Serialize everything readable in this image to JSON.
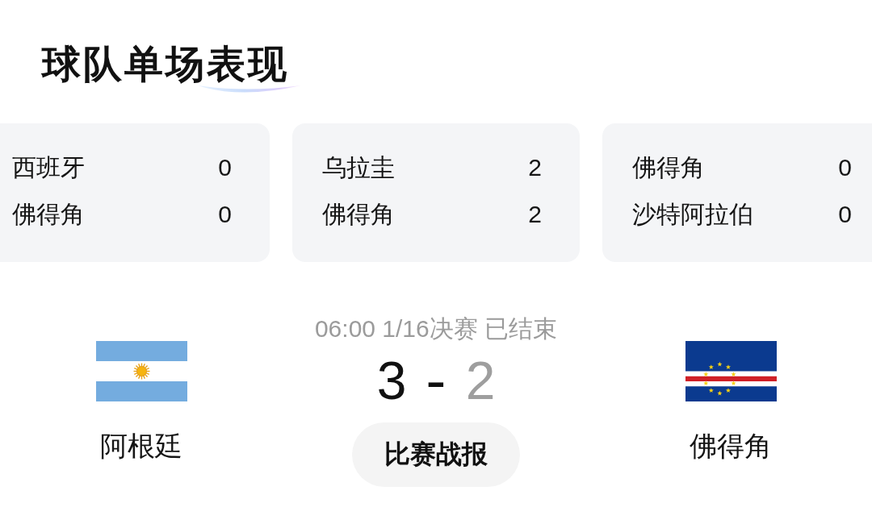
{
  "title": "球队单场表现",
  "matches": [
    {
      "teams": [
        {
          "name": "西班牙",
          "score": "0"
        },
        {
          "name": "佛得角",
          "score": "0"
        }
      ]
    },
    {
      "teams": [
        {
          "name": "乌拉圭",
          "score": "2"
        },
        {
          "name": "佛得角",
          "score": "2"
        }
      ]
    },
    {
      "teams": [
        {
          "name": "佛得角",
          "score": "0"
        },
        {
          "name": "沙特阿拉伯",
          "score": "0"
        }
      ]
    }
  ],
  "featured_match": {
    "status": "06:00 1/16决赛 已结束",
    "teams": [
      {
        "name": "阿根廷",
        "score": "3",
        "winner": true
      },
      {
        "name": "佛得角",
        "score": "2",
        "winner": false
      }
    ],
    "separator": "-",
    "report_button": "比赛战报"
  }
}
